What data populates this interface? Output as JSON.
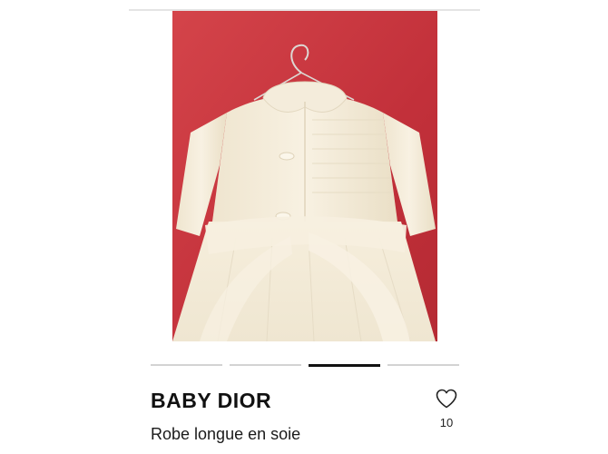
{
  "product": {
    "brand": "BABY DIOR",
    "description": "Robe longue en soie",
    "like_count": "10",
    "like_icon": "heart-outline-icon"
  },
  "gallery": {
    "image_count": 4,
    "active_index": 2
  },
  "colors": {
    "background": "#ffffff",
    "text": "#111111",
    "indicator_active": "#111111",
    "indicator_inactive": "#d3d3d3",
    "photo_backdrop": "#c9353c",
    "garment": "#f3ead7"
  }
}
